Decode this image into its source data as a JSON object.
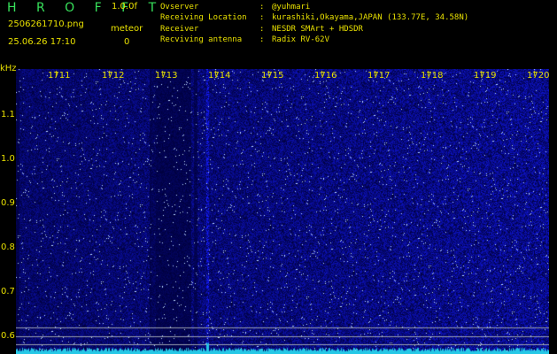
{
  "header": {
    "logo": "H R O F F T",
    "version": "1.0.0f",
    "filename": "2506261710.png",
    "meteor_label": "meteor",
    "datetime": "25.06.26 17:10",
    "meteor_count": "0"
  },
  "info": [
    {
      "key": "Ovserver",
      "value": "@yuhmari"
    },
    {
      "key": "Receiving Location",
      "value": "kurashiki,Okayama,JAPAN (133.77E, 34.58N)"
    },
    {
      "key": "Receiver",
      "value": "NESDR SMArt + HDSDR"
    },
    {
      "key": "Recviving antenna",
      "value": "Radix RV-62V"
    }
  ],
  "axis": {
    "y_unit": "kHz",
    "y_labels": [
      "1.1",
      "1.0",
      "0.9",
      "0.8",
      "0.7",
      "0.6"
    ],
    "x_labels": [
      "1711",
      "1712",
      "1713",
      "1714",
      "1715",
      "1716",
      "1717",
      "1718",
      "1719",
      "1720"
    ]
  },
  "colors": {
    "background": "#000000",
    "text": "#e8e000",
    "logo": "#37e15b",
    "spectrum_noise": "#1418a8",
    "trace": "#26c8e6"
  }
}
